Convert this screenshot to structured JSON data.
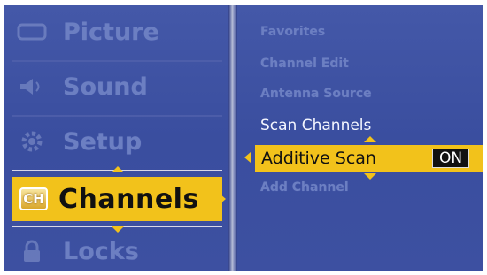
{
  "main_menu": {
    "items": [
      {
        "label": "Picture",
        "icon": "picture-icon"
      },
      {
        "label": "Sound",
        "icon": "speaker-icon"
      },
      {
        "label": "Setup",
        "icon": "gear-icon"
      },
      {
        "label": "Channels",
        "icon": "channels-icon",
        "icon_text": "CH",
        "selected": true
      },
      {
        "label": "Locks",
        "icon": "lock-icon"
      }
    ]
  },
  "sub_menu": {
    "items": [
      {
        "label": "Favorites"
      },
      {
        "label": "Channel Edit"
      },
      {
        "label": "Antenna Source"
      },
      {
        "label": "Scan Channels"
      },
      {
        "label": "Additive Scan",
        "value": "ON",
        "selected": true
      },
      {
        "label": "Add Channel"
      }
    ]
  },
  "colors": {
    "background": "#3d50a1",
    "highlight": "#f2c21b",
    "dim_text": "#6c7fc2"
  }
}
